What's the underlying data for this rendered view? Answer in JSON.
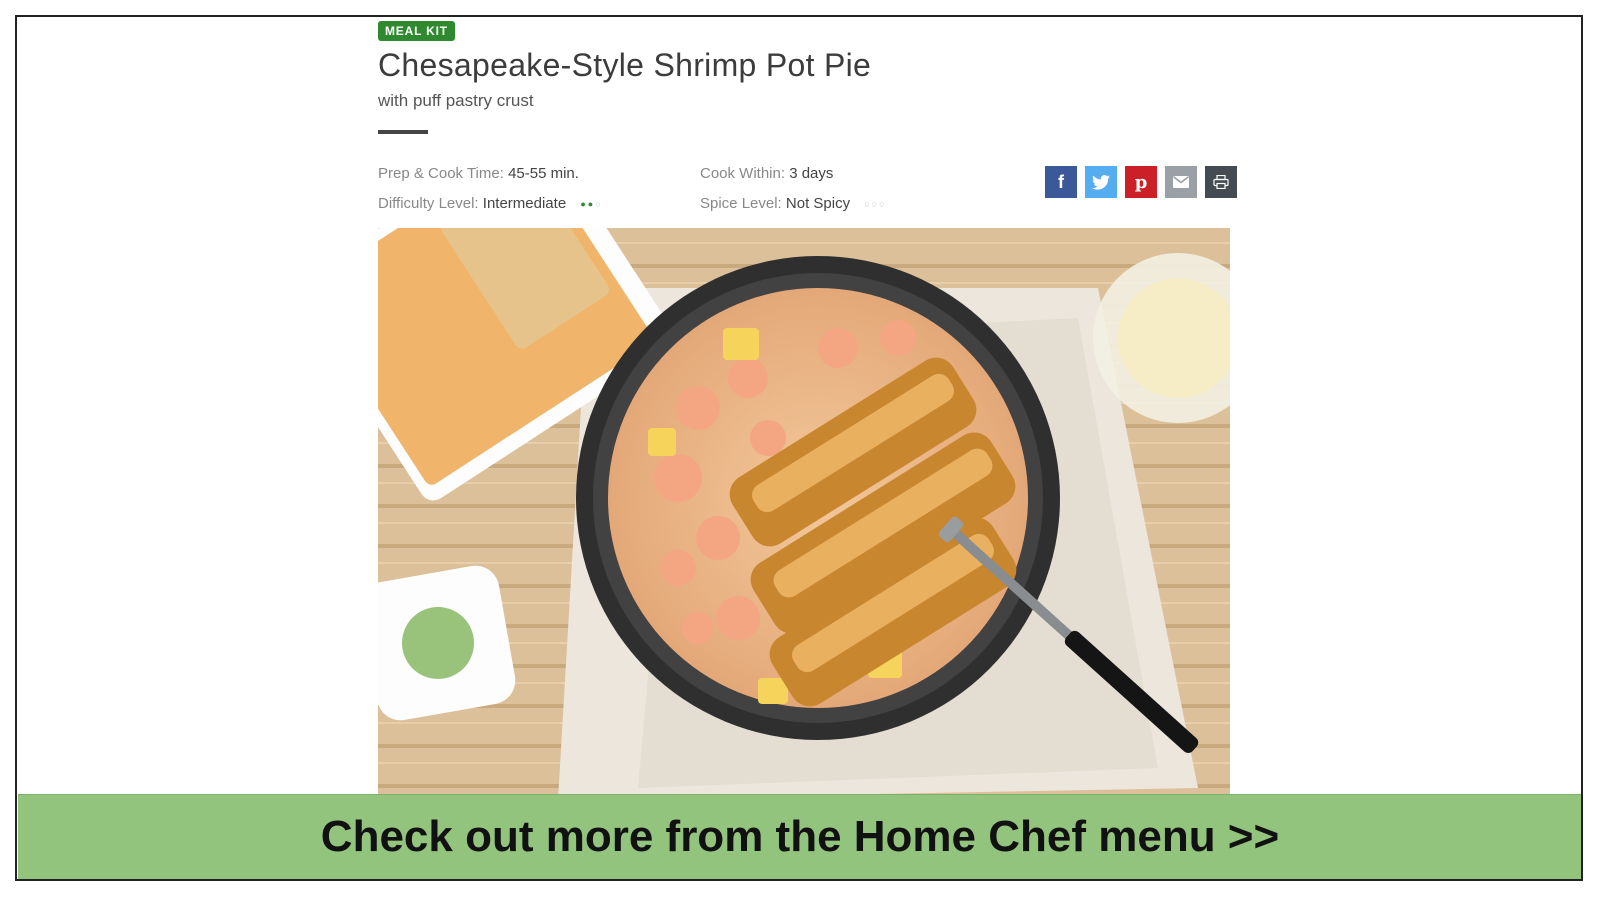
{
  "recipe": {
    "badge": "MEAL KIT",
    "title": "Chesapeake-Style Shrimp Pot Pie",
    "subtitle": "with puff pastry crust",
    "prep_label": "Prep & Cook Time:",
    "prep_value": "45-55 min.",
    "cook_within_label": "Cook Within:",
    "cook_within_value": "3 days",
    "difficulty_label": "Difficulty Level:",
    "difficulty_value": "Intermediate",
    "difficulty_level": 2,
    "difficulty_max": 3,
    "spice_label": "Spice Level:",
    "spice_value": "Not Spicy",
    "spice_level": 0,
    "spice_max": 3
  },
  "share": {
    "icons": [
      "facebook-icon",
      "twitter-icon",
      "pinterest-icon",
      "email-icon",
      "print-icon"
    ],
    "colors": {
      "facebook": "#3b5998",
      "twitter": "#55acee",
      "pinterest": "#cb2027",
      "email": "#9aa0a6",
      "print": "#444b52"
    }
  },
  "banner": {
    "text": "Check out more from the Home Chef menu >>"
  },
  "colors": {
    "accent": "#2f8a2f",
    "banner_bg": "#93c47d"
  }
}
